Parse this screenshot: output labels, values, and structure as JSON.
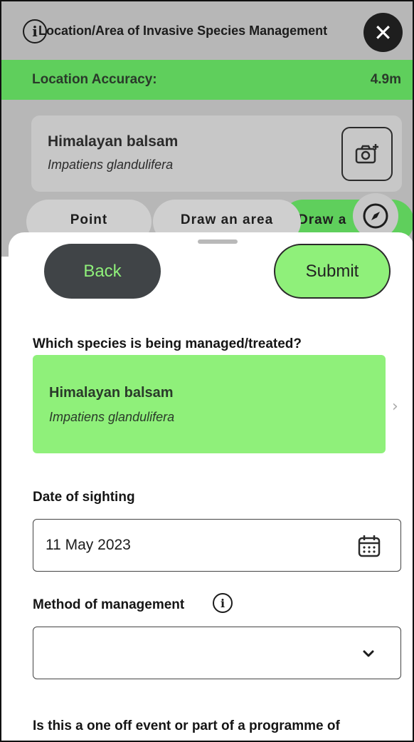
{
  "header": {
    "title": "Location/Area of Invasive Species Management",
    "info_icon": "info-icon",
    "close_icon": "close-icon"
  },
  "accuracy": {
    "label": "Location Accuracy:",
    "value": "4.9m"
  },
  "selected_species": {
    "common_name": "Himalayan balsam",
    "latin_name": "Impatiens glandulifera"
  },
  "mode_tabs": [
    {
      "label": "Point"
    },
    {
      "label": "Draw an area"
    },
    {
      "label": "Draw a"
    }
  ],
  "sheet": {
    "back_label": "Back",
    "submit_label": "Submit",
    "species_question": "Which species is being managed/treated?",
    "species_common": "Himalayan balsam",
    "species_latin": "Impatiens glandulifera",
    "date_label": "Date of sighting",
    "date_value": "11 May 2023",
    "method_label": "Method of management",
    "method_value": "",
    "programme_question": "Is this a one off event or part of a programme of"
  },
  "colors": {
    "accent_green": "#8ff07a",
    "accuracy_green": "#5fcf5c",
    "dark_button": "#404447"
  }
}
